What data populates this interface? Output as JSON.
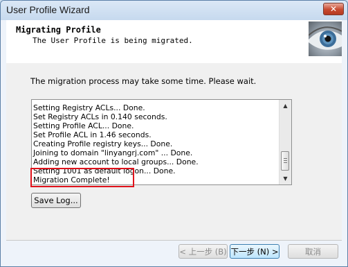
{
  "window": {
    "title": "User Profile Wizard",
    "close_symbol": "✕"
  },
  "header": {
    "title": "Migrating Profile",
    "subtitle": "The User Profile is being migrated.",
    "image_icon": "eye-icon"
  },
  "content": {
    "intro": "The migration process may take some time. Please wait.",
    "log_lines": [
      "Setting Registry ACLs... Done.",
      "Set Registry ACLs in 0.140 seconds.",
      "Setting Profile ACL... Done.",
      "Set Profile ACL in 1.46 seconds.",
      "Creating Profile registry keys... Done.",
      "Joining to domain \"linyangrj.com\" ... Done.",
      "Adding new account to local groups... Done.",
      "Setting 1001 as default logon... Done.",
      "Migration Complete!"
    ],
    "scroll_up": "▲",
    "scroll_down": "▼",
    "save_log_label": "Save Log..."
  },
  "footer": {
    "back_label": "< 上一步 (B)",
    "next_label": "下一步 (N) >",
    "cancel_label": "取消"
  },
  "colors": {
    "highlight_box": "#e0121b",
    "title_bar": "#c6d9ee"
  }
}
